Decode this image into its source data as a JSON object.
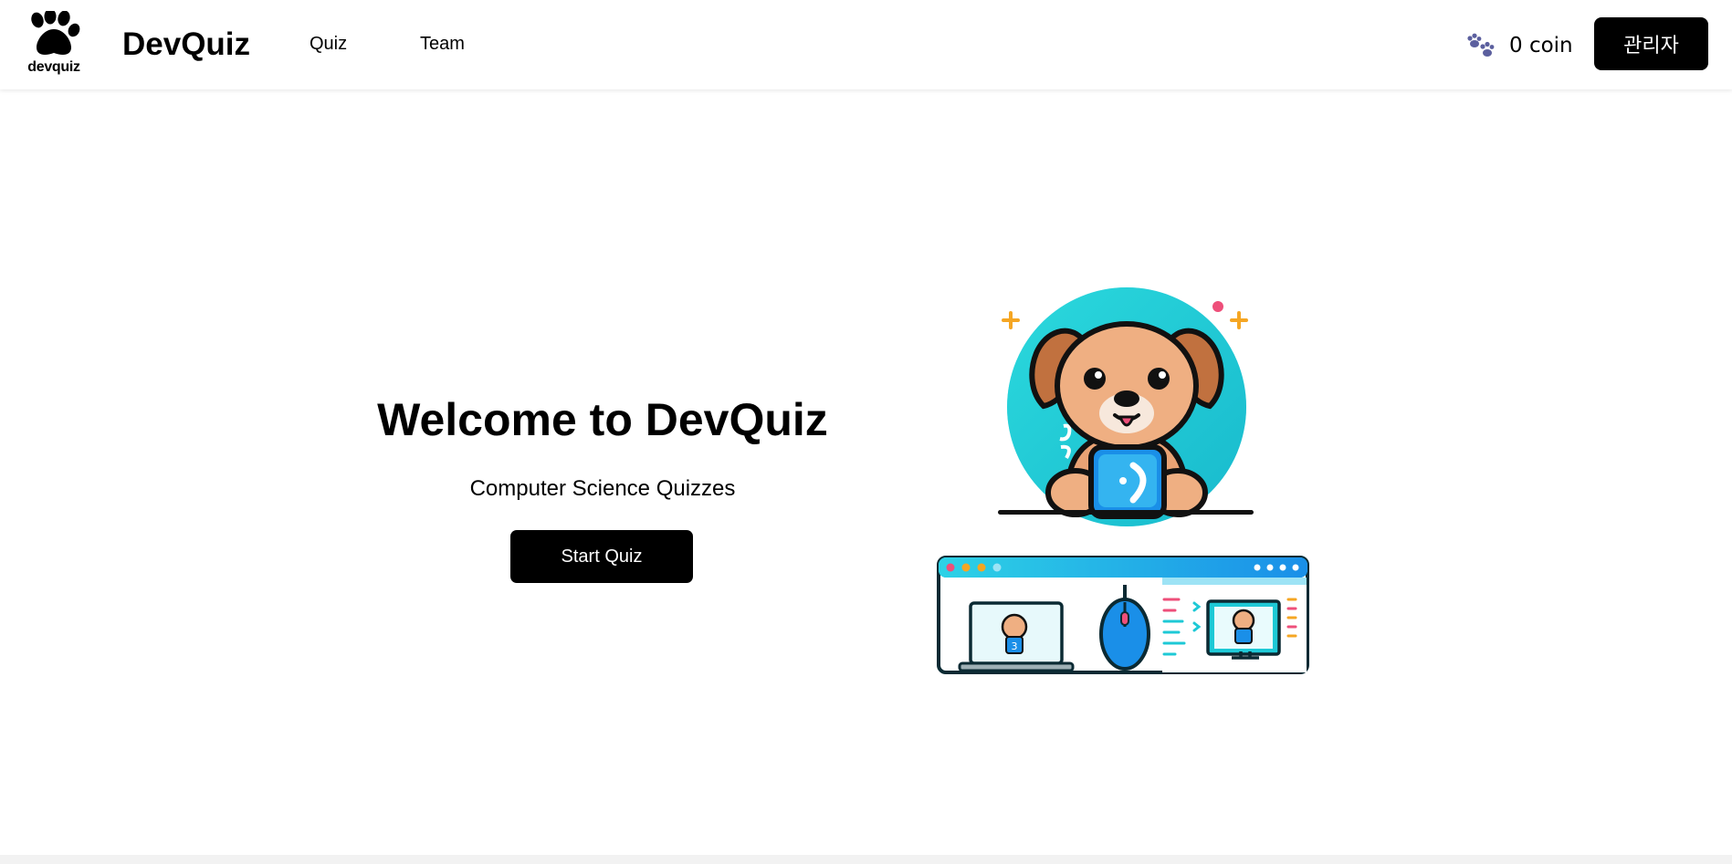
{
  "header": {
    "logo_icon": "paw-icon",
    "logo_text": "devquiz",
    "brand": "DevQuiz",
    "nav": [
      {
        "label": "Quiz"
      },
      {
        "label": "Team"
      }
    ],
    "coin_icon": "paw-prints-icon",
    "coin_text": "0 coin",
    "admin_label": "관리자"
  },
  "hero": {
    "title": "Welcome to DevQuiz",
    "subtitle": "Computer Science Quizzes",
    "start_label": "Start Quiz"
  },
  "colors": {
    "primary": "#000000",
    "background": "#ffffff",
    "accent_teal": "#1ec9d6",
    "accent_blue": "#1a8fe8"
  }
}
